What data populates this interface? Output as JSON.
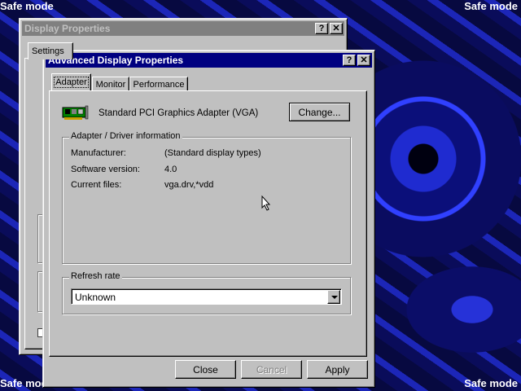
{
  "desktop": {
    "safe_mode_label": "Safe mode"
  },
  "display_properties": {
    "title": "Display Properties",
    "tab_partial": "Settings"
  },
  "advanced": {
    "title": "Advanced Display Properties",
    "help_symbol": "?",
    "close_symbol": "✕",
    "tabs": [
      {
        "label": "Adapter",
        "selected": true
      },
      {
        "label": "Monitor",
        "selected": false
      },
      {
        "label": "Performance",
        "selected": false
      }
    ],
    "adapter_name": "Standard PCI Graphics Adapter (VGA)",
    "change_button": "Change...",
    "driver_group": {
      "label": "Adapter / Driver information",
      "rows": [
        {
          "key": "Manufacturer:",
          "value": "(Standard display types)"
        },
        {
          "key": "Software version:",
          "value": "4.0"
        },
        {
          "key": "Current files:",
          "value": "vga.drv,*vdd"
        }
      ]
    },
    "refresh_group": {
      "label": "Refresh rate",
      "value": "Unknown"
    },
    "buttons": {
      "close": "Close",
      "cancel": "Cancel",
      "apply": "Apply"
    }
  }
}
